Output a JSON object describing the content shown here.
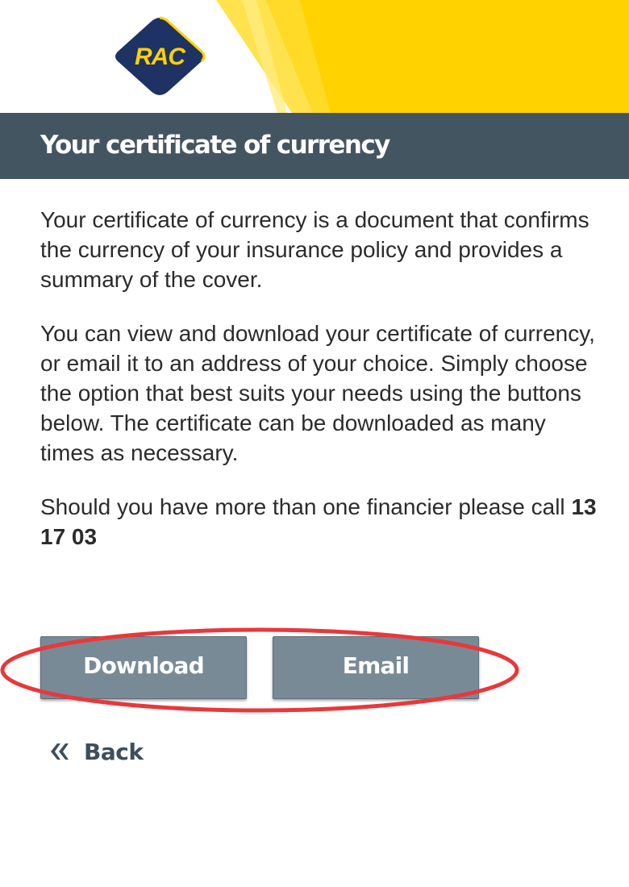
{
  "brand": {
    "logo_text": "RAC",
    "yellow": "#FFD200",
    "navy": "#1E3263",
    "slate": "#445562"
  },
  "header": {
    "title": "Your certificate of currency"
  },
  "body": {
    "paragraph_1": "Your certificate of currency is a document that confirms the currency of your insurance policy and provides a summary of the cover.",
    "paragraph_2": "You can view and download your certificate of currency, or email it to an address of your choice. Simply choose the option that best suits your needs using the buttons below. The certificate can be downloaded as many times as necessary.",
    "paragraph_3_prefix": "Should you have more than one financier please call ",
    "phone": "13 17 03"
  },
  "actions": {
    "download_label": "Download",
    "email_label": "Email",
    "button_color": "#798A97",
    "highlight_color": "#E8383B"
  },
  "nav": {
    "back_label": "Back",
    "back_icon": "double-chevron-left-icon"
  }
}
